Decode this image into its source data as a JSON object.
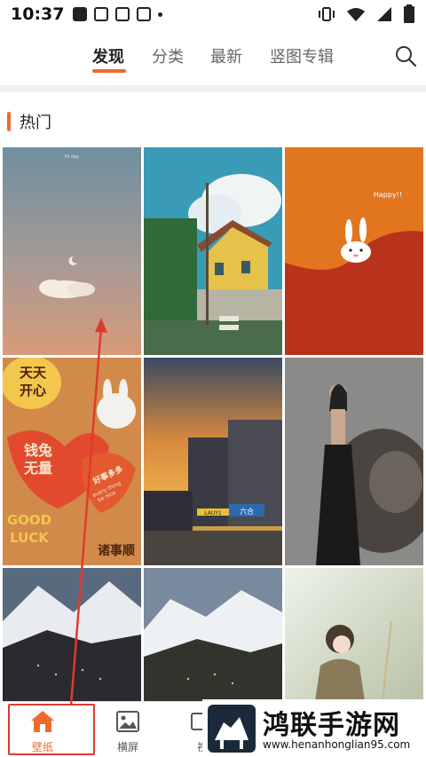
{
  "status_bar": {
    "time": "10:37"
  },
  "top_tabs": [
    {
      "label": "发现",
      "active": true
    },
    {
      "label": "分类",
      "active": false
    },
    {
      "label": "最新",
      "active": false
    },
    {
      "label": "竖图专辑",
      "active": false
    }
  ],
  "accent_color": "#ee6a2c",
  "section": {
    "title": "热门"
  },
  "tiles": [
    {
      "name": "wallpaper-sky-cloud",
      "caption": "Hi day"
    },
    {
      "name": "wallpaper-anime-village"
    },
    {
      "name": "wallpaper-bunny-happy",
      "caption": "Happy!!"
    },
    {
      "name": "wallpaper-chinese-hearts",
      "texts": [
        "天天",
        "开心",
        "钱兔",
        "无量",
        "好事多多",
        "GOOD",
        "LUCK",
        "every thing",
        "be nice",
        "诸事顺"
      ]
    },
    {
      "name": "wallpaper-city-sunset",
      "texts": [
        "六合",
        "LAUY1"
      ]
    },
    {
      "name": "wallpaper-woman-lion"
    },
    {
      "name": "wallpaper-alpine-village-1"
    },
    {
      "name": "wallpaper-alpine-village-2"
    },
    {
      "name": "wallpaper-anime-girl"
    }
  ],
  "bottom_nav": [
    {
      "label": "壁纸",
      "icon": "home-icon",
      "active": true
    },
    {
      "label": "横屏",
      "icon": "image-icon",
      "active": false
    },
    {
      "label": "视",
      "icon": "video-icon",
      "active": false
    }
  ],
  "watermark": {
    "title": "鸿联手游网",
    "url": "www.henanhonglian95.com"
  }
}
